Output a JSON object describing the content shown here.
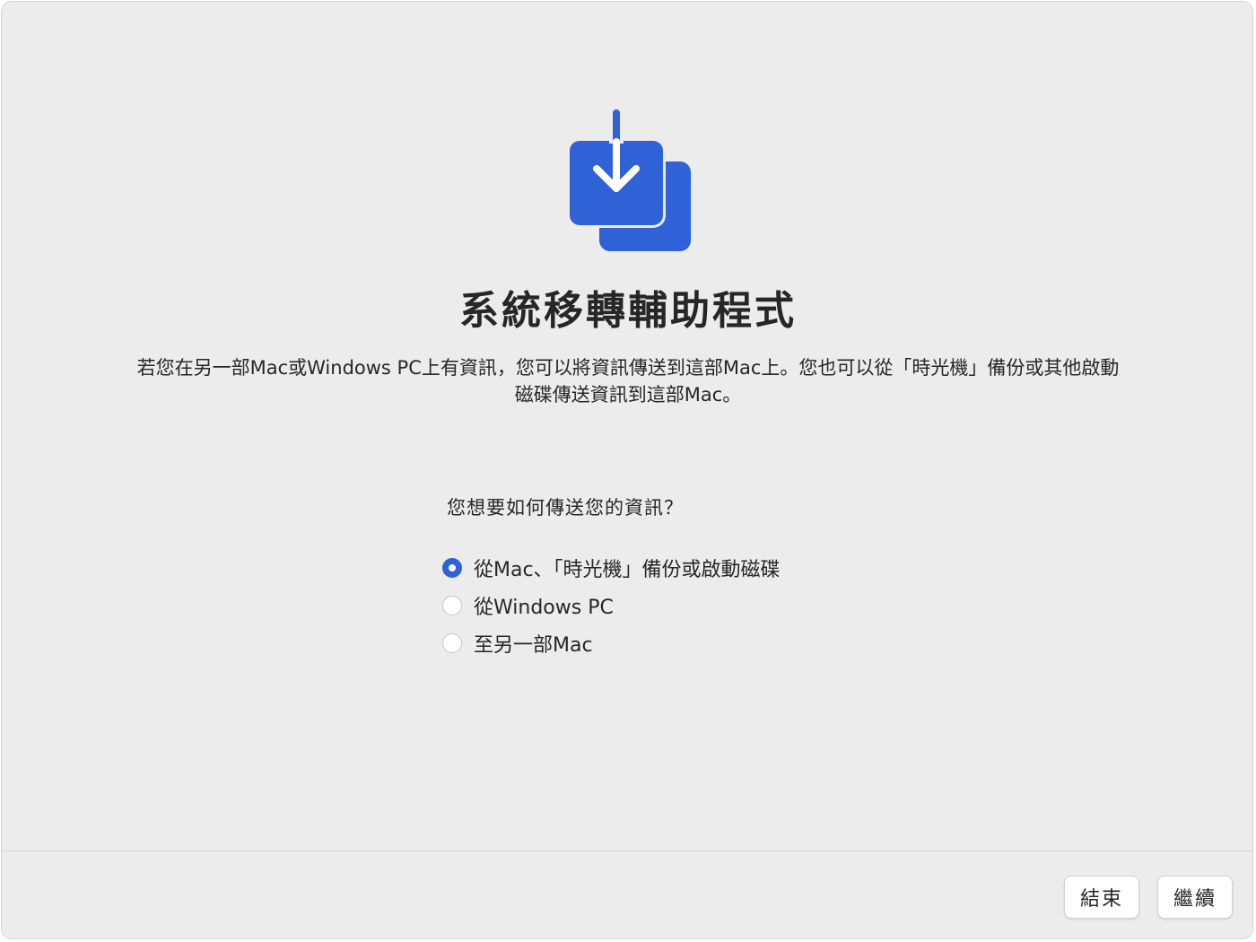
{
  "window": {
    "title": "系統移轉輔助程式",
    "description": "若您在另一部Mac或Windows PC上有資訊，您可以將資訊傳送到這部Mac上。您也可以從「時光機」備份或其他啟動磁碟傳送資訊到這部Mac。",
    "icon": "migration-assistant-icon"
  },
  "question": "您想要如何傳送您的資訊？",
  "options": [
    {
      "label": "從Mac、「時光機」備份或啟動磁碟",
      "selected": true
    },
    {
      "label": "從Windows PC",
      "selected": false
    },
    {
      "label": "至另一部Mac",
      "selected": false
    }
  ],
  "buttons": {
    "quit_label": "結束",
    "continue_label": "繼續"
  },
  "colors": {
    "accent": "#2e62d6",
    "background": "#ececec"
  }
}
